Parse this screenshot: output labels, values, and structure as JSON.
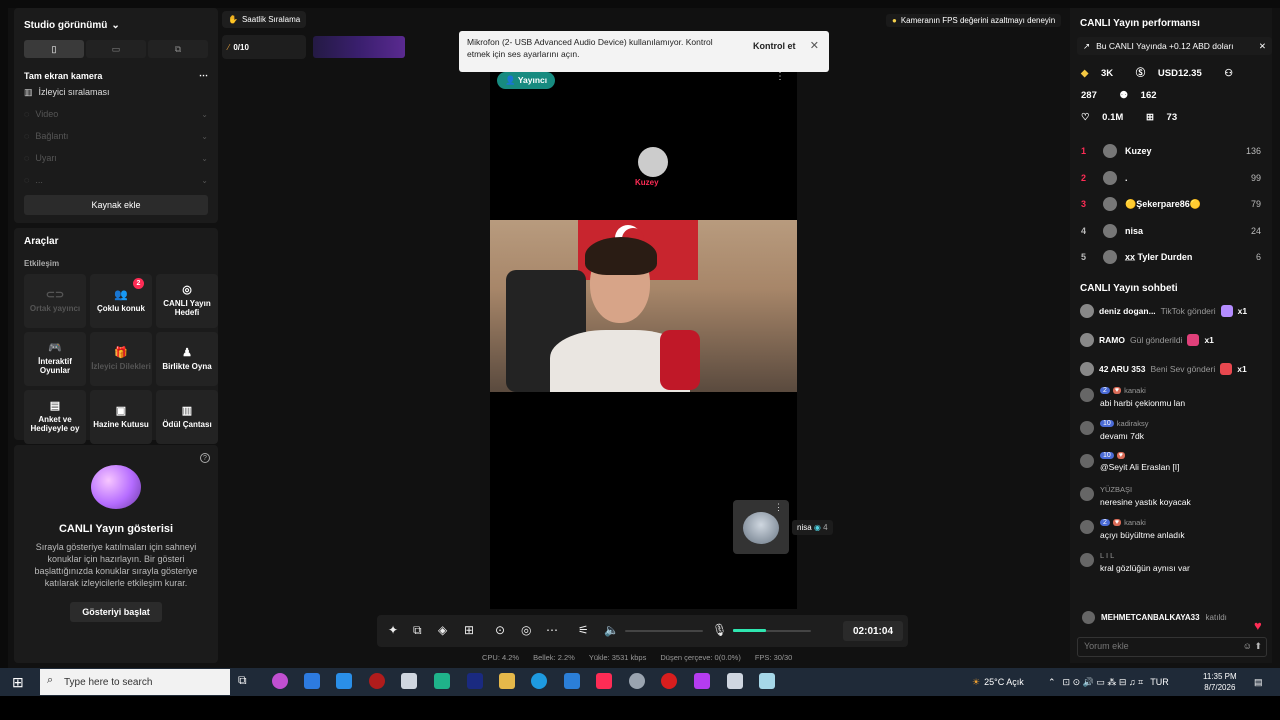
{
  "studio": {
    "title": "Studio görünümü",
    "camera_title": "Tam ekran kamera",
    "sources": [
      {
        "label": "İzleyici sıralaması",
        "dim": false
      },
      {
        "label": "Video",
        "dim": true
      },
      {
        "label": "Bağlantı",
        "dim": true
      },
      {
        "label": "Uyarı",
        "dim": true
      },
      {
        "label": "...",
        "dim": true
      }
    ],
    "add_source": "Kaynak ekle"
  },
  "tools": {
    "title": "Araçlar",
    "section": "Etkileşim",
    "items": [
      {
        "label": "Ortak yayıncı",
        "icon": "link-icon",
        "glyph": "⊂⊃",
        "dim": true
      },
      {
        "label": "Çoklu konuk",
        "icon": "users-icon",
        "glyph": "👥",
        "dim": false,
        "badge": "2"
      },
      {
        "label": "CANLI Yayın Hedefi",
        "icon": "target-icon",
        "glyph": "◎",
        "dim": false
      },
      {
        "label": "İnteraktif Oyunlar",
        "icon": "gamepad-icon",
        "glyph": "🎮",
        "dim": false
      },
      {
        "label": "İzleyici Dilekleri",
        "icon": "gift-icon",
        "glyph": "🎁",
        "dim": true
      },
      {
        "label": "Birlikte Oyna",
        "icon": "play-together-icon",
        "glyph": "♟",
        "dim": false
      },
      {
        "label": "Anket ve Hediyeyle oy",
        "icon": "poll-icon",
        "glyph": "▤",
        "dim": false
      },
      {
        "label": "Hazine Kutusu",
        "icon": "treasure-icon",
        "glyph": "▣",
        "dim": false
      },
      {
        "label": "Ödül Çantası",
        "icon": "bag-icon",
        "glyph": "▥",
        "dim": false
      }
    ]
  },
  "show": {
    "title": "CANLI Yayın gösterisi",
    "desc": "Sırayla gösteriye katılmaları için sahneyi konuklar için hazırlayın. Bir gösteri başlattığınızda konuklar sırayla gösteriye katılarak izleyicilerle etkileşim kurar.",
    "button": "Gösteriyi başlat"
  },
  "top": {
    "hourly_rank": "Saatlik Sıralama",
    "progress": "0/10",
    "toast_text": "Mikrofon (2- USB Advanced Audio Device) kullanılamıyor. Kontrol etmek için ses ayarlarını açın.",
    "toast_action": "Kontrol et",
    "fps_tip": "Kameranın FPS değerini azaltmayı deneyin"
  },
  "stream": {
    "host_tag": "Yayıncı",
    "guest_name": "Kuzey",
    "pip_name": "nisa",
    "pip_count": "4"
  },
  "controls": {
    "timer": "02:01:04",
    "mic_level": 0.42
  },
  "stats": {
    "cpu": "CPU: 4.2%",
    "memory": "Bellek: 2.2%",
    "upload": "Yükle: 3531 kbps",
    "dropped": "Düşen çerçeve: 0(0.0%)",
    "fps": "FPS: 30/30"
  },
  "perf": {
    "title": "CANLI Yayın performansı",
    "banner": "Bu CANLI Yayında +0.12 ABD doları",
    "m1": "3K",
    "m2": "USD12.35",
    "m3": "287",
    "m4": "162",
    "m5": "0.1M",
    "m6": "73"
  },
  "ranking": [
    {
      "rank": "1",
      "name": "Kuzey",
      "score": "136"
    },
    {
      "rank": "2",
      "name": ".",
      "score": "99"
    },
    {
      "rank": "3",
      "name": "🟡Şekerpare86🟡",
      "score": "79"
    },
    {
      "rank": "4",
      "name": "nisa",
      "score": "24"
    },
    {
      "rank": "5",
      "name": "x̲x̲ Tyler Durden",
      "score": "6"
    }
  ],
  "chat": {
    "title": "CANLI Yayın sohbeti",
    "gifts": [
      {
        "user": "deniz dogan...",
        "text": "TikTok gönderi",
        "count": "x1",
        "color": "#b48cff"
      },
      {
        "user": "RAMO",
        "text": "Gül gönderildi",
        "count": "x1",
        "color": "#e0407a"
      },
      {
        "user": "42 ARU 353",
        "text": "Beni Sev gönderi",
        "count": "x1",
        "color": "#e8484f"
      }
    ],
    "messages": [
      {
        "user": "kanaki",
        "level": "2",
        "fan": "♥",
        "text": "abi harbi çekionmu lan"
      },
      {
        "user": "kadiraksy",
        "level": "10",
        "fan": "",
        "text": "devamı 7dk"
      },
      {
        "user": "",
        "level": "10",
        "fan": "♥",
        "text": "@Seyit Ali Eraslan [I]"
      },
      {
        "user": "YÜZBAŞI",
        "level": "",
        "fan": "",
        "text": "neresine yastık koyacak"
      },
      {
        "user": "kanaki",
        "level": "2",
        "fan": "♥",
        "text": "açıyı büyültme anladık"
      },
      {
        "user": "L I L",
        "level": "",
        "fan": "",
        "text": "kral gözlüğün aynısı var"
      }
    ],
    "joined_user": "MEHMETCANBALKAYA33",
    "joined_text": "katıldı",
    "comment_placeholder": "Yorum ekle"
  },
  "taskbar": {
    "search": "Type here to search",
    "weather": "25°C Açık",
    "lang": "TUR",
    "time": "11:35 PM",
    "date": "8/7/2026"
  }
}
